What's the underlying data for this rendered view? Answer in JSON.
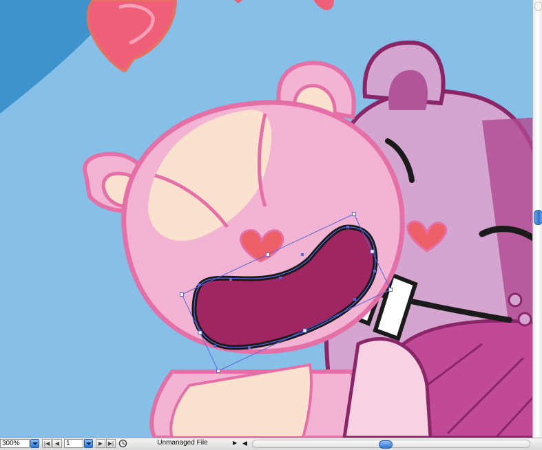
{
  "window": {
    "document": {
      "objects": [
        "sky-background",
        "hearts",
        "pink-character",
        "purple-beaver-character",
        "selected-mouth-path"
      ]
    }
  },
  "statusbar": {
    "zoom_value": "300%",
    "page_value": "1",
    "status_text": "Unmanaged File",
    "first_page_symbol": "|◀",
    "prev_page_symbol": "◀",
    "next_page_symbol": "▶",
    "last_page_symbol": "▶|",
    "menu_arrow_symbol": "▶"
  },
  "colors": {
    "sky": "#86c0e8",
    "sky_dark": "#3e93cc",
    "pink_fur": "#f2b4d2",
    "cream": "#fbe2cf",
    "pink_outline": "#e56fa7",
    "purple_fur": "#d4a6cf",
    "purple_outline": "#8a2668",
    "mouth": "#a02560",
    "nose": "#ee6068",
    "selection": "#5a64d6"
  }
}
